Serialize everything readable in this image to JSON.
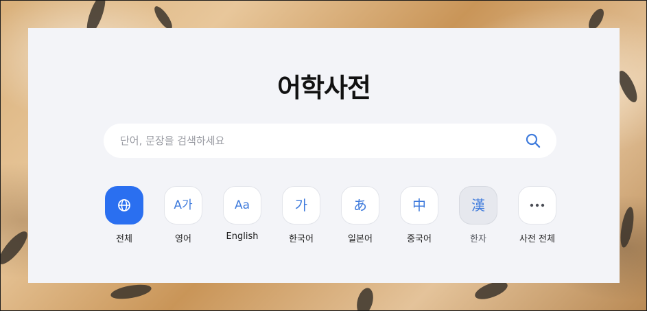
{
  "page": {
    "title": "어학사전"
  },
  "search": {
    "placeholder": "단어, 문장을 검색하세요",
    "value": "",
    "icon": "search-icon"
  },
  "categories": [
    {
      "label": "전체",
      "glyph": "",
      "icon": "globe-icon",
      "active": true
    },
    {
      "label": "영어",
      "glyph": "A가",
      "icon": "english-korean-icon",
      "active": false
    },
    {
      "label": "English",
      "glyph": "Aa",
      "icon": "english-icon",
      "active": false
    },
    {
      "label": "한국어",
      "glyph": "가",
      "icon": "korean-icon",
      "active": false
    },
    {
      "label": "일본어",
      "glyph": "あ",
      "icon": "japanese-icon",
      "active": false
    },
    {
      "label": "중국어",
      "glyph": "中",
      "icon": "chinese-icon",
      "active": false
    },
    {
      "label": "한자",
      "glyph": "漢",
      "icon": "hanja-icon",
      "active": false
    },
    {
      "label": "사전 전체",
      "glyph": "•••",
      "icon": "more-icon",
      "active": false
    }
  ],
  "colors": {
    "accent": "#2a6ff0",
    "icon": "#3f7bdc",
    "panel": "#f3f4f8"
  }
}
